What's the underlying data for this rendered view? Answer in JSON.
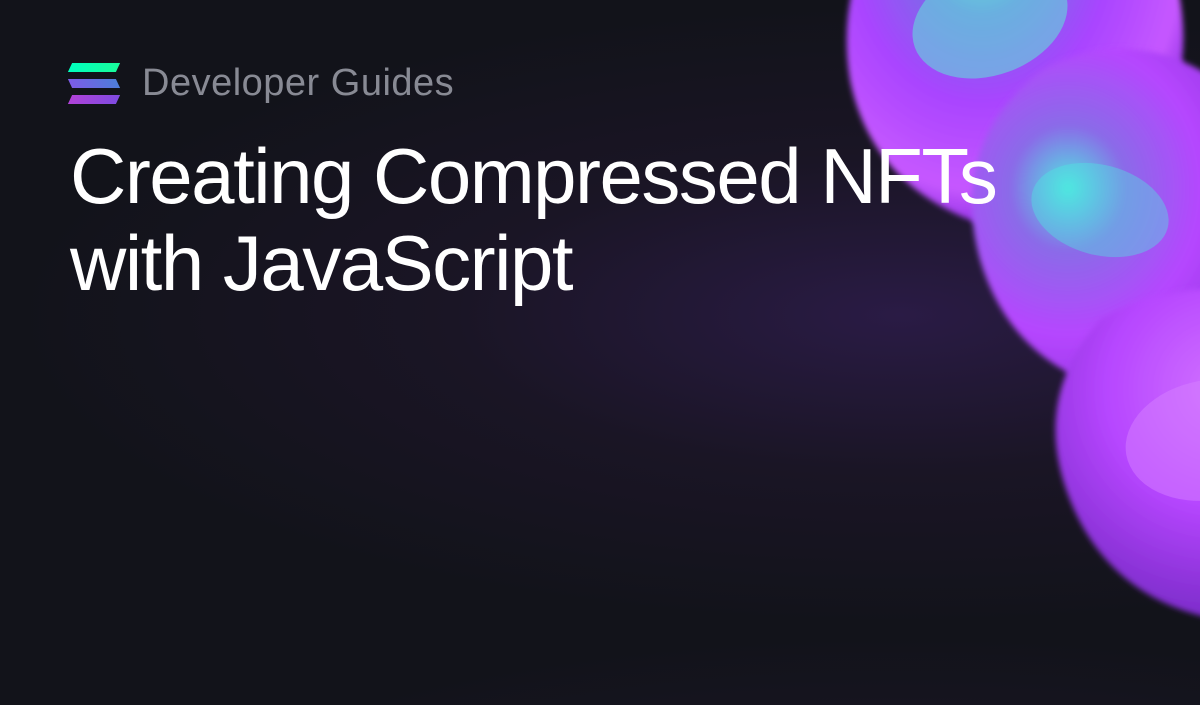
{
  "header": {
    "category": "Developer Guides"
  },
  "title": "Creating Compressed NFTs with JavaScript",
  "colors": {
    "background": "#12131a",
    "category_text": "#888a94",
    "title_text": "#ffffff",
    "logo_green": "#00ffbd",
    "logo_blue": "#4d7dd8",
    "logo_purple": "#b042d8",
    "blob_purple": "#a944ff",
    "blob_cyan": "#4ee8e0"
  }
}
